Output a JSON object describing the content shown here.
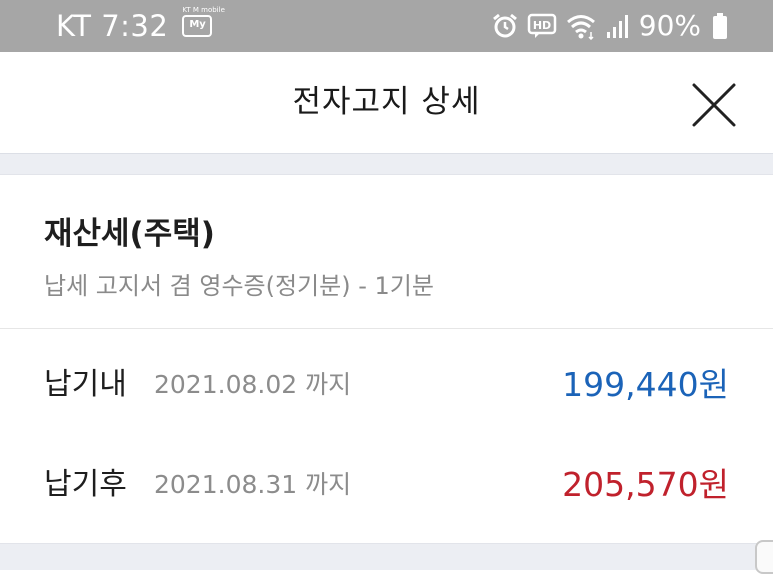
{
  "status_bar": {
    "carrier_time": "KT 7:32",
    "badge_top_text": "KT M mobile",
    "badge_text": "My",
    "hd_label": "HD",
    "battery_percent": "90%",
    "icons": [
      "alarm-icon",
      "hd-voice-icon",
      "wifi-icon",
      "signal-icon",
      "battery-icon"
    ],
    "battery_level": 0.9
  },
  "header": {
    "title": "전자고지 상세",
    "close_icon": "close-icon"
  },
  "bill": {
    "title": "재산세(주택)",
    "subtitle": "납세 고지서 겸 영수증(정기분) - 1기분"
  },
  "payments": [
    {
      "label": "납기내",
      "due_date": "2021.08.02 까지",
      "amount": "199,440원",
      "amount_color": "#1b63b8"
    },
    {
      "label": "납기후",
      "due_date": "2021.08.31 까지",
      "amount": "205,570원",
      "amount_color": "#c0212c"
    }
  ],
  "colors": {
    "status_bar_bg": "#a6a6a6",
    "band_bg": "#eceef3",
    "amount_before": "#1b63b8",
    "amount_after": "#c0212c"
  }
}
